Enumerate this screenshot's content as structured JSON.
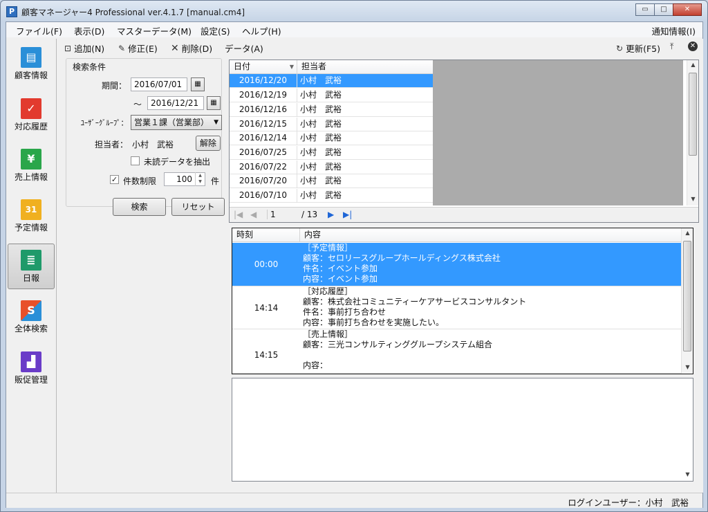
{
  "window": {
    "title": "顧客マネージャー4 Professional ver.4.1.7 [manual.cm4]",
    "app_icon": "P",
    "min": "▭",
    "max": "□",
    "close": "✕"
  },
  "menu": {
    "items": [
      "ファイル(F)",
      "表示(D)",
      "マスターデータ(M)",
      "設定(S)",
      "ヘルプ(H)"
    ],
    "notify": "通知情報(I)"
  },
  "nav": [
    {
      "label": "顧客情報",
      "icon": "customer-card-icon",
      "color": "#2a8fd8",
      "glyph": "▤"
    },
    {
      "label": "対応履歴",
      "icon": "check-icon",
      "color": "#e23a2e",
      "glyph": "✓"
    },
    {
      "label": "売上情報",
      "icon": "yen-icon",
      "color": "#2aa64a",
      "glyph": "¥"
    },
    {
      "label": "予定情報",
      "icon": "calendar-icon",
      "color": "#f0b020",
      "glyph": "31"
    },
    {
      "label": "日報",
      "icon": "report-icon",
      "color": "#1f9a6a",
      "glyph": "≣"
    },
    {
      "label": "全体検索",
      "icon": "search-s-icon",
      "color": "#e8502a",
      "glyph": "S"
    },
    {
      "label": "販促管理",
      "icon": "chart-bar-icon",
      "color": "#6a3cc8",
      "glyph": "▟"
    }
  ],
  "toolbar": {
    "add": "追加(N)",
    "edit": "修正(E)",
    "delete": "削除(D)",
    "data": "データ(A)",
    "refresh": "更新(F5)"
  },
  "search": {
    "group_title": "検索条件",
    "period_label": "期間：",
    "from": "2016/07/01",
    "tilde": "～",
    "to": "2016/12/21",
    "cal_glyph": "▦",
    "group_label": "ﾕｰｻﾞｰｸﾞﾙｰﾌﾟ：",
    "group_value": "営業１課（営業部）",
    "person_label": "担当者：",
    "person_value": "小村　武裕",
    "release": "解除",
    "unread_label": "未読データを抽出",
    "limit_label": "件数制限",
    "limit_value": "100",
    "limit_unit": "件",
    "search_btn": "検索",
    "reset_btn": "リセット"
  },
  "list": {
    "headers": {
      "date": "日付",
      "person": "担当者"
    },
    "rows": [
      {
        "date": "2016/12/20",
        "person": "小村　武裕"
      },
      {
        "date": "2016/12/19",
        "person": "小村　武裕"
      },
      {
        "date": "2016/12/16",
        "person": "小村　武裕"
      },
      {
        "date": "2016/12/15",
        "person": "小村　武裕"
      },
      {
        "date": "2016/12/14",
        "person": "小村　武裕"
      },
      {
        "date": "2016/07/25",
        "person": "小村　武裕"
      },
      {
        "date": "2016/07/22",
        "person": "小村　武裕"
      },
      {
        "date": "2016/07/20",
        "person": "小村　武裕"
      },
      {
        "date": "2016/07/10",
        "person": "小村　武裕"
      }
    ],
    "page": "1",
    "total": "/ 13"
  },
  "detail": {
    "headers": {
      "time": "時刻",
      "content": "内容"
    },
    "rows": [
      {
        "time": "00:00",
        "lines": [
          "［予定情報］",
          "顧客：セロリースグループホールディングス株式会社",
          "件名：イベント参加",
          "内容：イベント参加"
        ]
      },
      {
        "time": "14:14",
        "lines": [
          "［対応履歴］",
          "顧客：株式会社コミュニティーケアサービスコンサルタント",
          "件名：事前打ち合わせ",
          "内容：事前打ち合わせを実施したい。"
        ]
      },
      {
        "time": "14:15",
        "lines": [
          "［売上情報］",
          "顧客：三光コンサルティンググループシステム組合",
          "",
          "内容："
        ]
      }
    ]
  },
  "status": {
    "login": "ログインユーザー：小村　武裕"
  }
}
